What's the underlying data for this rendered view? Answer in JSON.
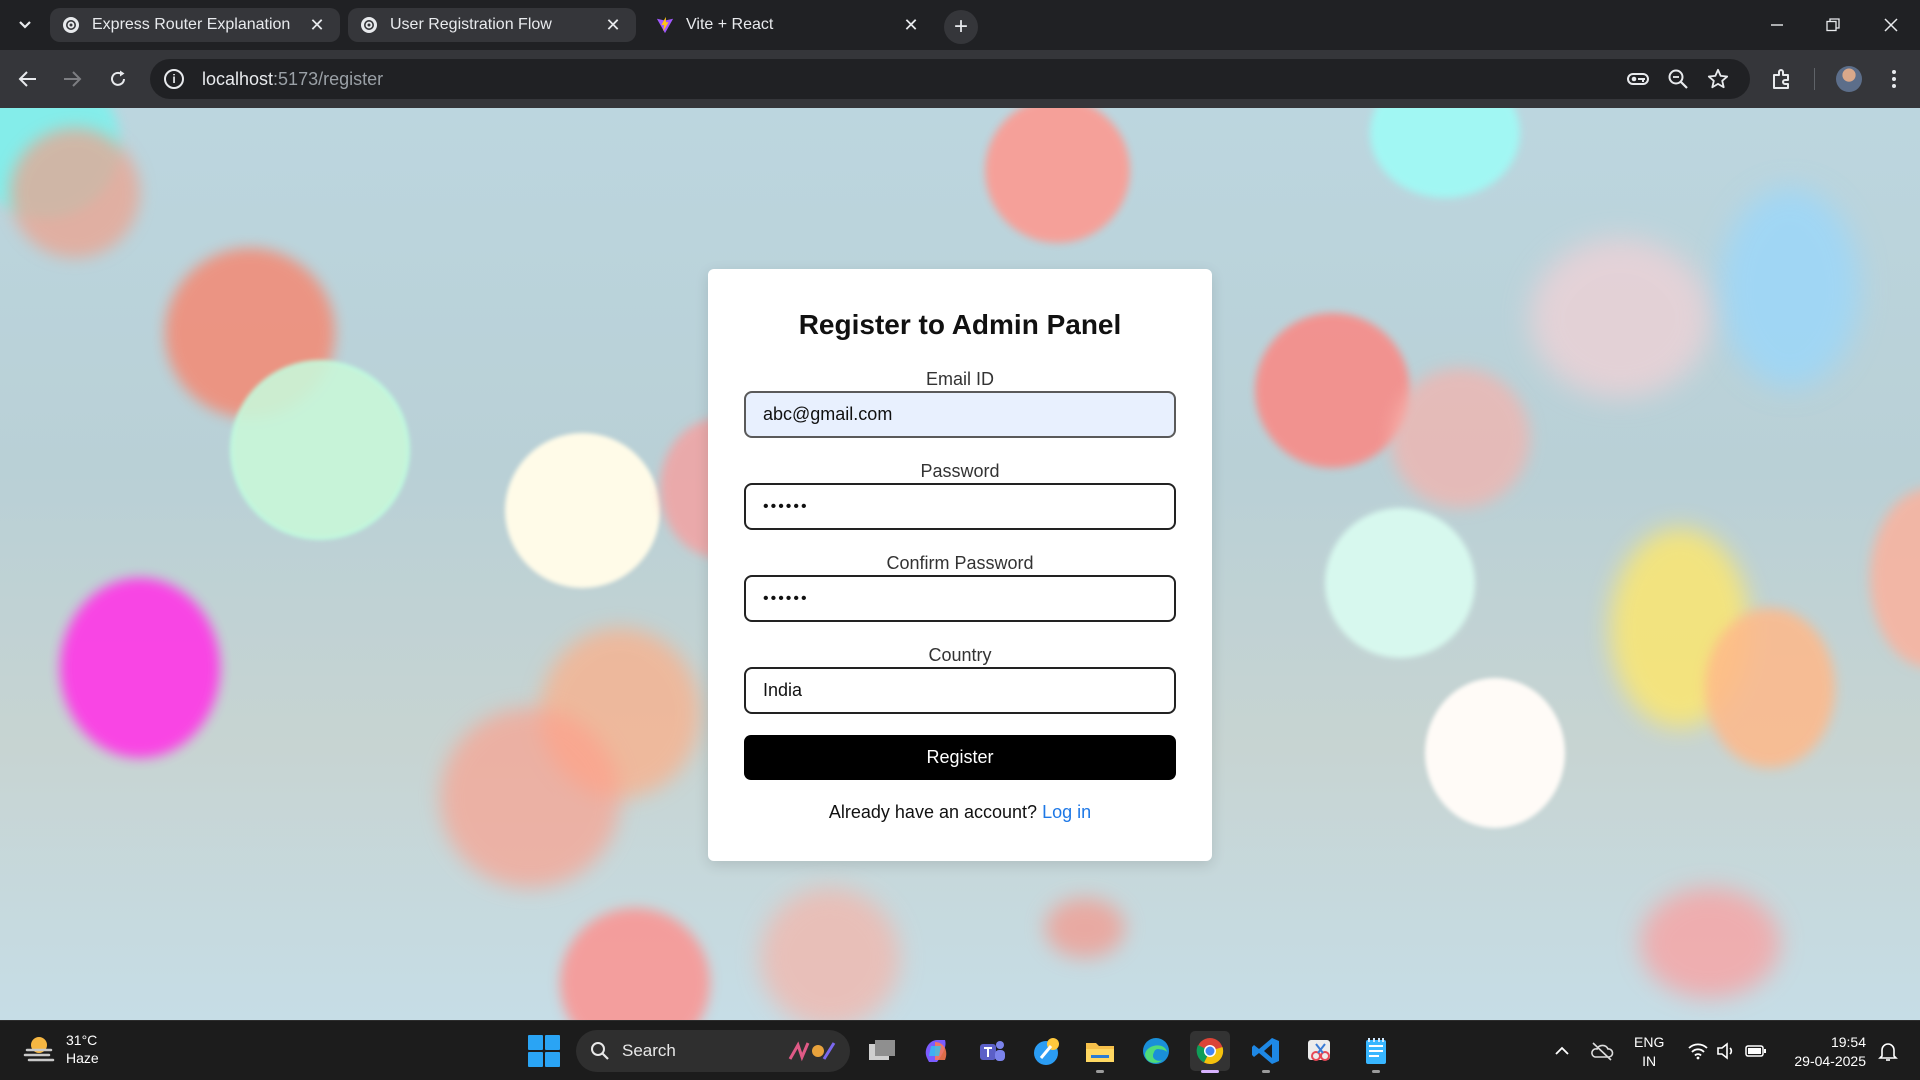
{
  "browser": {
    "tabs": [
      {
        "title": "Express Router Explanation",
        "close": "✕"
      },
      {
        "title": "User Registration Flow",
        "close": "✕"
      },
      {
        "title": "Vite + React",
        "close": "✕"
      }
    ],
    "new_tab": "+",
    "url_host": "localhost",
    "url_path": ":5173/register"
  },
  "form": {
    "title": "Register to Admin Panel",
    "email_label": "Email ID",
    "email_value": "abc@gmail.com",
    "password_label": "Password",
    "password_value": "••••••",
    "confirm_label": "Confirm Password",
    "confirm_value": "••••••",
    "country_label": "Country",
    "country_value": "India",
    "submit_label": "Register",
    "login_prompt": "Already have an account?",
    "login_link": "Log in"
  },
  "taskbar": {
    "temperature": "31°C",
    "condition": "Haze",
    "search_label": "Search",
    "lang_line1": "ENG",
    "lang_line2": "IN",
    "time": "19:54",
    "date": "29-04-2025"
  },
  "colors": {
    "accent_link": "#1e78e6",
    "button_bg": "#000000",
    "autofill_bg": "#e8f0fe",
    "chrome_dark": "#202124",
    "chrome_toolbar": "#35363a"
  },
  "icons": [
    "chatgpt-icon",
    "vite-icon",
    "info-icon",
    "key-icon",
    "zoom-icon",
    "star-icon",
    "extensions-icon",
    "menu-icon",
    "windows-icon",
    "search-icon",
    "wifi-icon",
    "volume-icon",
    "battery-icon"
  ]
}
